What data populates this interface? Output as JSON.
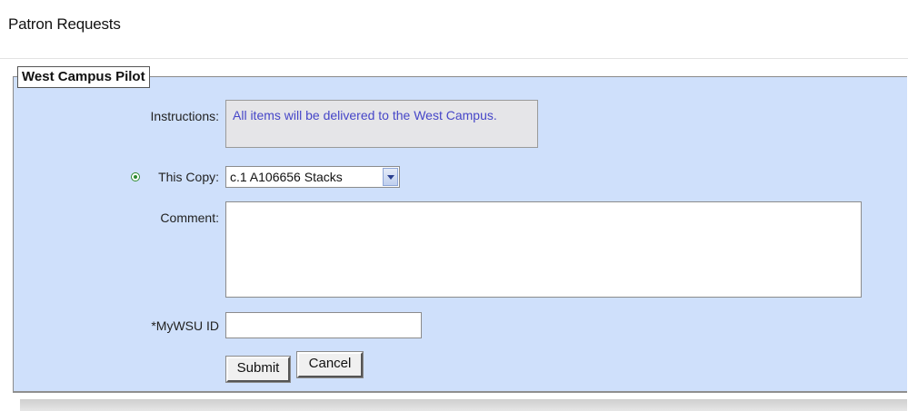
{
  "page": {
    "title": "Patron Requests"
  },
  "form": {
    "legend": "West Campus Pilot",
    "instructions": {
      "label": "Instructions:",
      "text": "All items will be delivered to the West Campus."
    },
    "copy": {
      "radio_icon": "radio-selected-icon",
      "label": "This Copy:",
      "selected_value": "c.1 A106656 Stacks",
      "dropdown_icon": "chevron-down-icon"
    },
    "comment": {
      "label": "Comment:",
      "value": ""
    },
    "mywsu_id": {
      "label": "*MyWSU ID",
      "value": ""
    },
    "buttons": {
      "submit_label": "Submit",
      "cancel_label": "Cancel"
    }
  },
  "colors": {
    "panel_background": "#cfe0fb",
    "instructions_text": "#4646c8",
    "instructions_background": "#e5e5e8"
  }
}
